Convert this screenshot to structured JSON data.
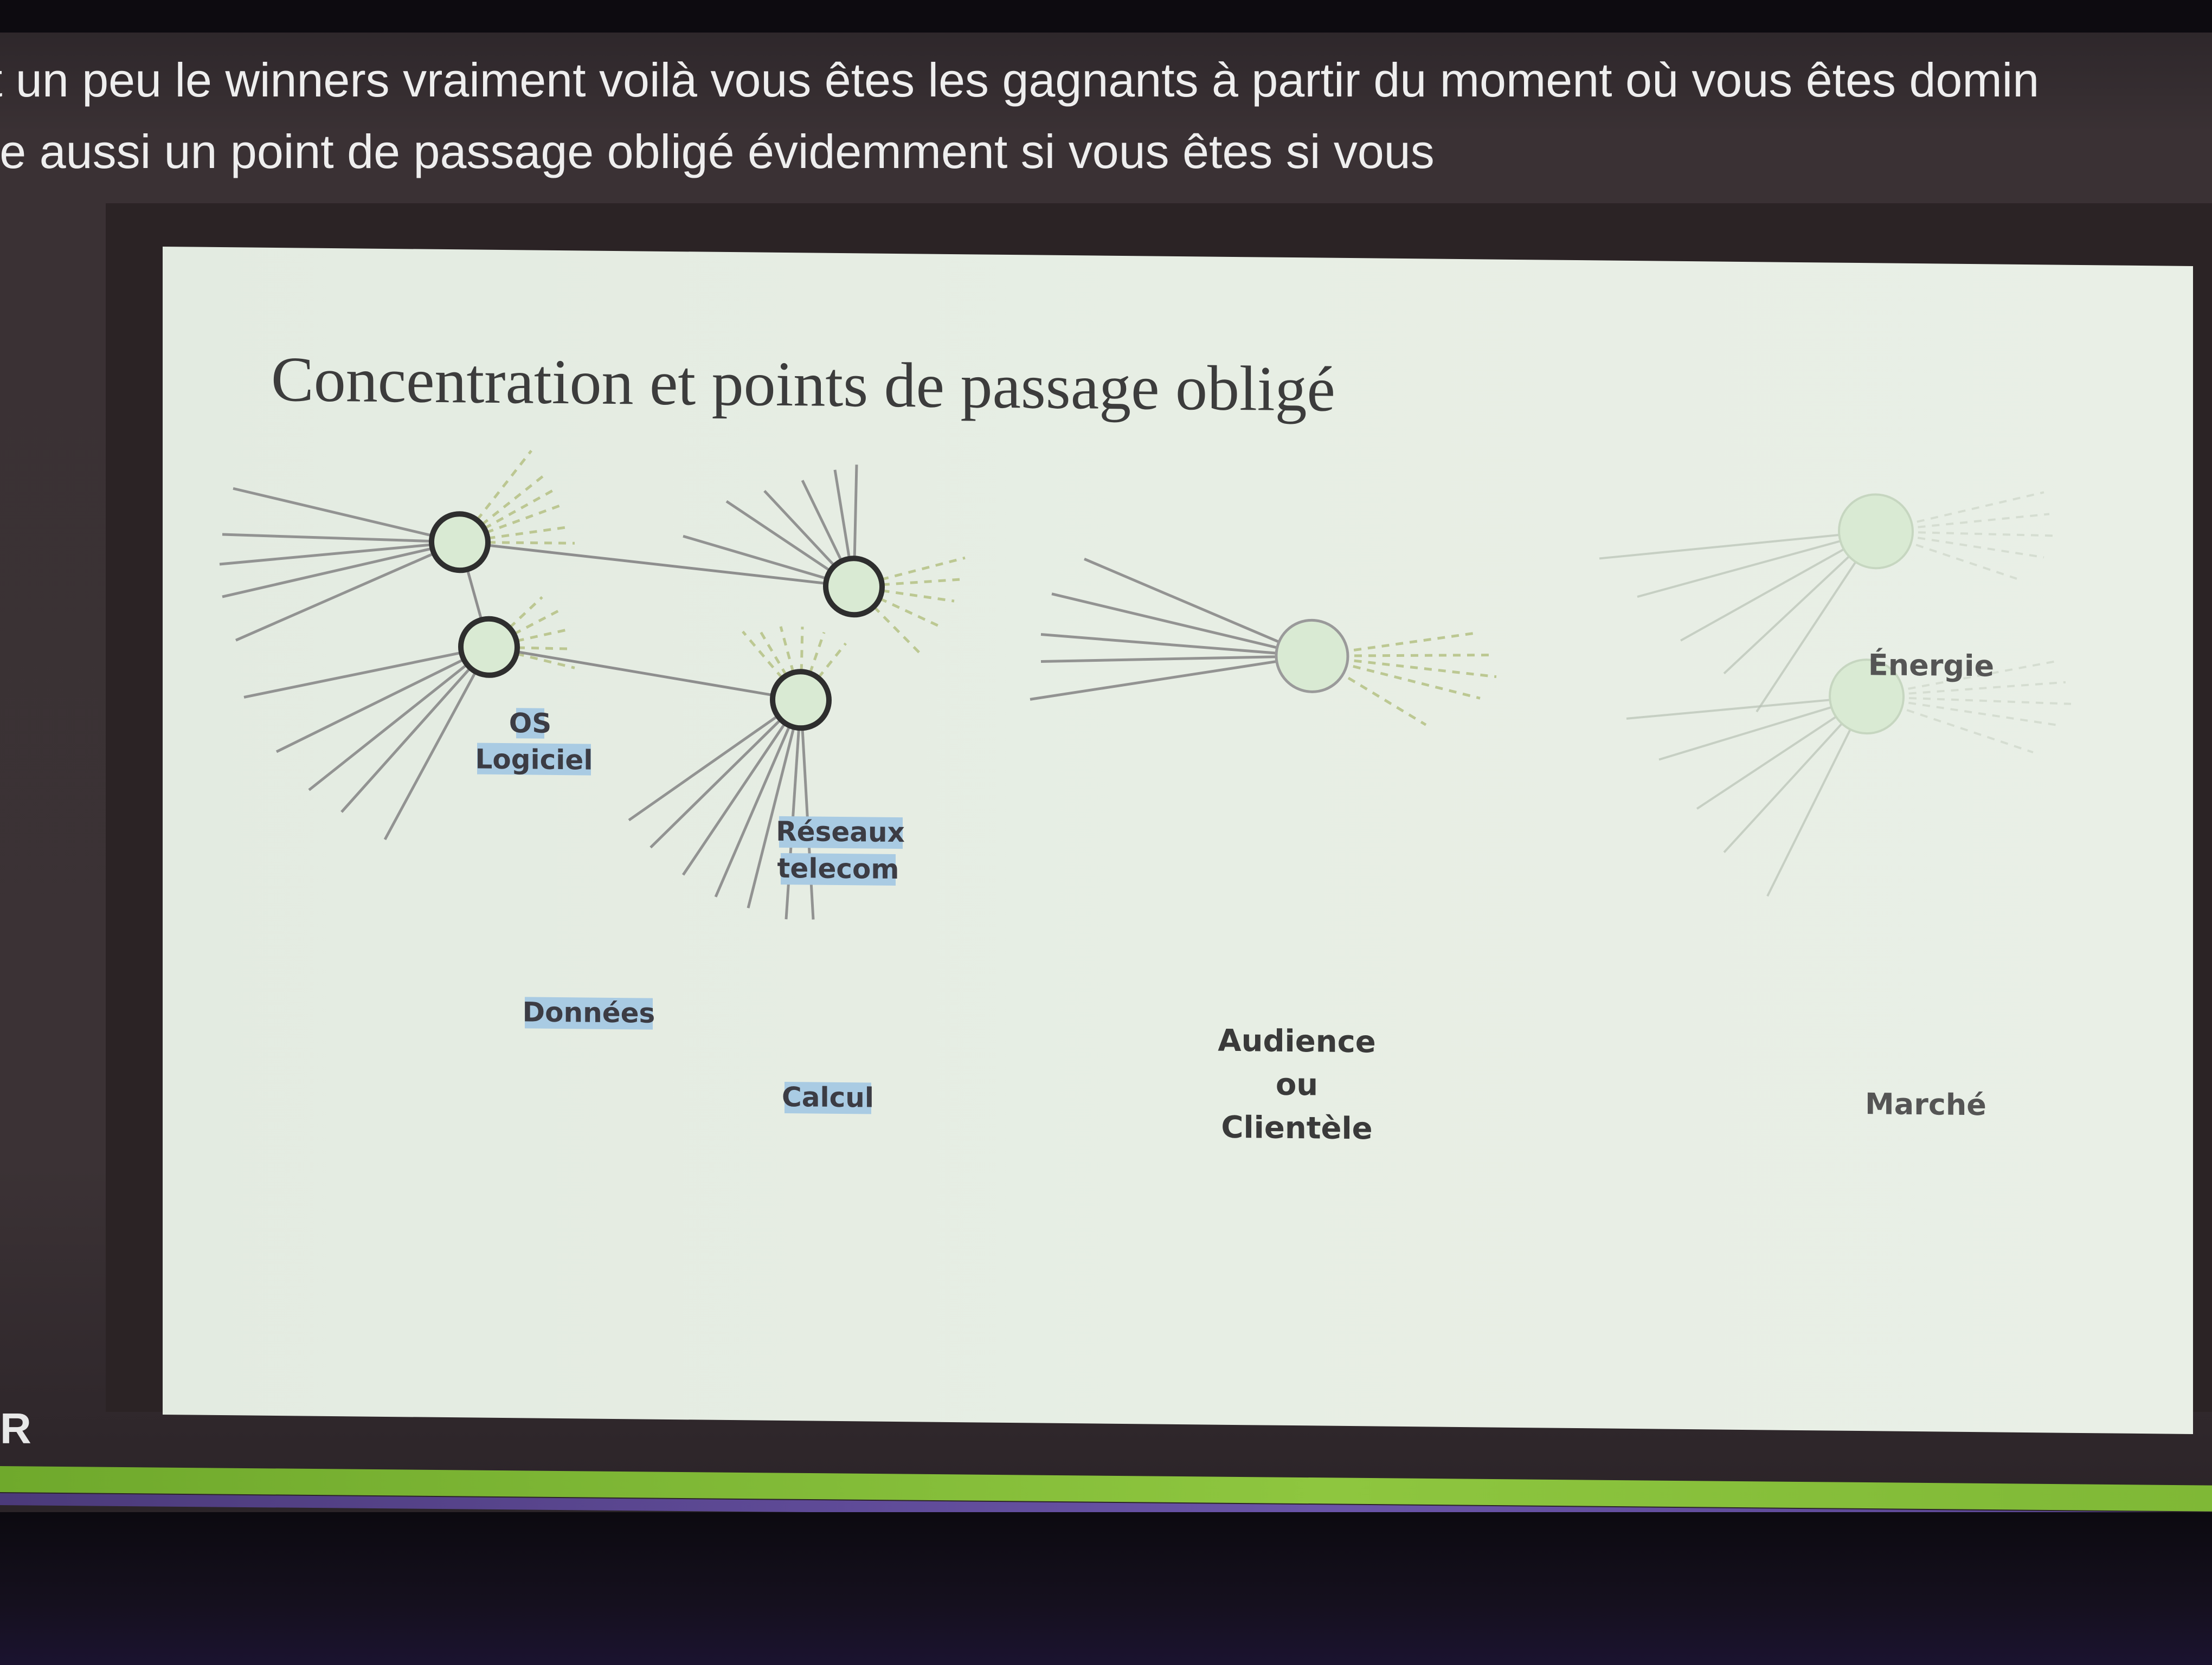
{
  "caption": {
    "line1": "t un peu le winners vraiment voilà vous êtes les gagnants à partir du moment où vous êtes domin",
    "line2": "re aussi un point de passage obligé évidemment si vous êtes si vous"
  },
  "slide": {
    "title": "Concentration et points de passage obligé"
  },
  "nodes": {
    "os_logiciel": {
      "line1": "OS",
      "line2": "Logiciel"
    },
    "reseaux_telecom": {
      "line1": "Réseaux",
      "line2": "telecom"
    },
    "donnees": {
      "label": "Données"
    },
    "calcul": {
      "label": "Calcul"
    },
    "audience": {
      "line1": "Audience",
      "line2": "ou",
      "line3": "Clientèle"
    },
    "energie": {
      "label": "Énergie"
    },
    "marche": {
      "label": "Marché"
    }
  },
  "footer": {
    "logo_fragment": "R"
  },
  "colors": {
    "slide_bg": "#e5ece2",
    "node_fill": "#d9ead3",
    "highlight": "#a9cbe3",
    "line": "#8a8a8a",
    "dashed": "#b8c48a",
    "accent_green": "#8ec63f",
    "accent_purple": "#5a4690"
  }
}
